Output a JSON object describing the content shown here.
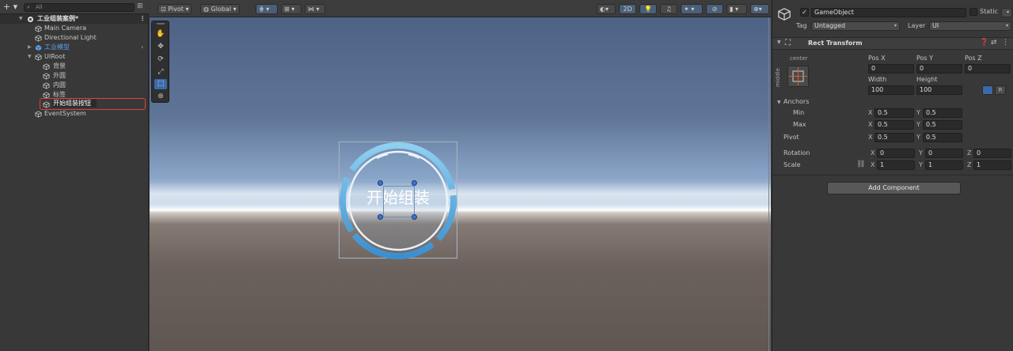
{
  "hierarchy": {
    "add_label": "+ ▾",
    "search_placeholder": "All",
    "items": [
      {
        "label": "工业组装案例*",
        "depth": 0
      },
      {
        "label": "Main Camera",
        "depth": 1
      },
      {
        "label": "Directional Light",
        "depth": 1
      },
      {
        "label": "工业模型",
        "depth": 1
      },
      {
        "label": "UIRoot",
        "depth": 1
      },
      {
        "label": "背景",
        "depth": 2
      },
      {
        "label": "外圆",
        "depth": 2
      },
      {
        "label": "内圆",
        "depth": 2
      },
      {
        "label": "标签",
        "depth": 2
      },
      {
        "label": "开始组装按钮",
        "depth": 2
      },
      {
        "label": "EventSystem",
        "depth": 1
      }
    ]
  },
  "scene": {
    "toolbar": {
      "pivot": "Pivot",
      "global": "Global",
      "mode_2d": "2D"
    },
    "button_text": "开始组装"
  },
  "inspector": {
    "object_name": "GameObject",
    "static_label": "Static",
    "tag_label": "Tag",
    "tag_value": "Untagged",
    "layer_label": "Layer",
    "layer_value": "UI",
    "component_title": "Rect Transform",
    "anchor_h": "center",
    "anchor_v": "middle",
    "pos_x_label": "Pos X",
    "pos_y_label": "Pos Y",
    "pos_z_label": "Pos Z",
    "pos_x": "0",
    "pos_y": "0",
    "pos_z": "0",
    "width_label": "Width",
    "height_label": "Height",
    "width": "100",
    "height": "100",
    "r_button": "R",
    "anchors_label": "Anchors",
    "min_label": "Min",
    "max_label": "Max",
    "pivot_label": "Pivot",
    "rotation_label": "Rotation",
    "scale_label": "Scale",
    "axis_x": "X",
    "axis_y": "Y",
    "axis_z": "Z",
    "min_x": "0.5",
    "min_y": "0.5",
    "max_x": "0.5",
    "max_y": "0.5",
    "pivot_x": "0.5",
    "pivot_y": "0.5",
    "rot_x": "0",
    "rot_y": "0",
    "rot_z": "0",
    "scale_x": "1",
    "scale_y": "1",
    "scale_z": "1",
    "add_component": "Add Component"
  },
  "colors": {
    "accent_blue": "#3b6aa8",
    "ring_blue": "#5aa8e0",
    "highlight_red": "#e04040",
    "prefab_blue": "#5fa0e6"
  }
}
